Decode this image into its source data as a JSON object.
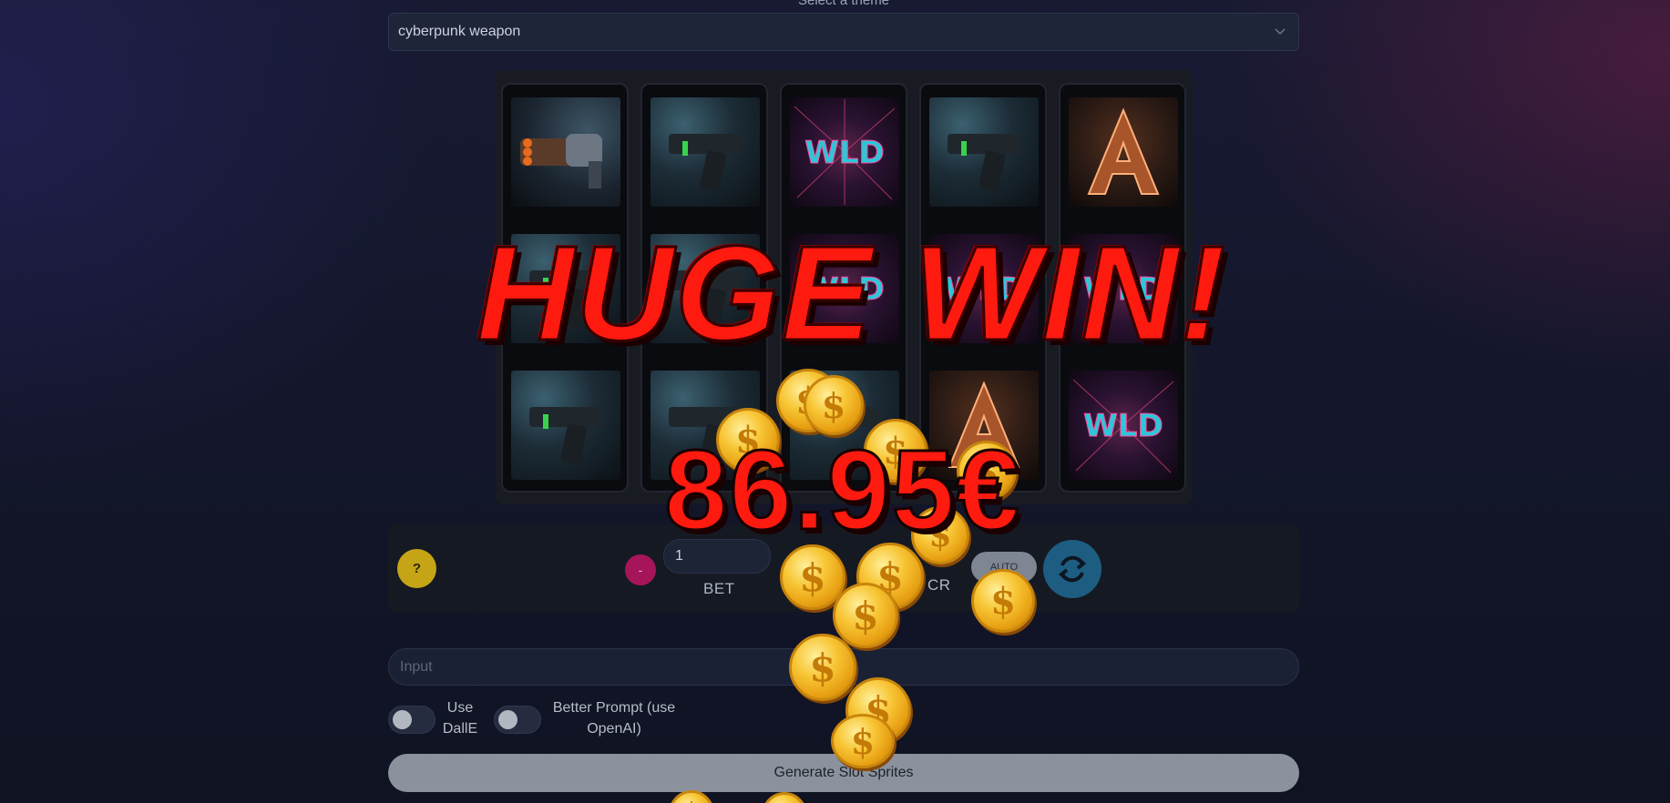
{
  "theme": {
    "label": "Select a theme",
    "selected": "cyberpunk weapon"
  },
  "slot": {
    "reels": [
      [
        "rotary blaster",
        "cyber pistol",
        "cyber pistol"
      ],
      [
        "cyber pistol",
        "cyber pistol",
        "cyber pistol"
      ],
      [
        "wild",
        "wild",
        "cyber pistol"
      ],
      [
        "cyber pistol",
        "wild",
        "letter A"
      ],
      [
        "letter A",
        "wild",
        "wild"
      ]
    ]
  },
  "controls": {
    "help_label": "?",
    "minus_label": "-",
    "bet_value": "1",
    "bet_label": "BET",
    "credit_label": "CR",
    "auto_label": "AUTO"
  },
  "prompt": {
    "label": "Input",
    "placeholder": "Input",
    "use_dalle_label": "Use DallE",
    "better_prompt_label": "Better Prompt (use OpenAI)",
    "generate_label": "Generate Slot Sprites"
  },
  "overlay": {
    "headline": "HUGE WIN!",
    "amount": "86.95€"
  }
}
